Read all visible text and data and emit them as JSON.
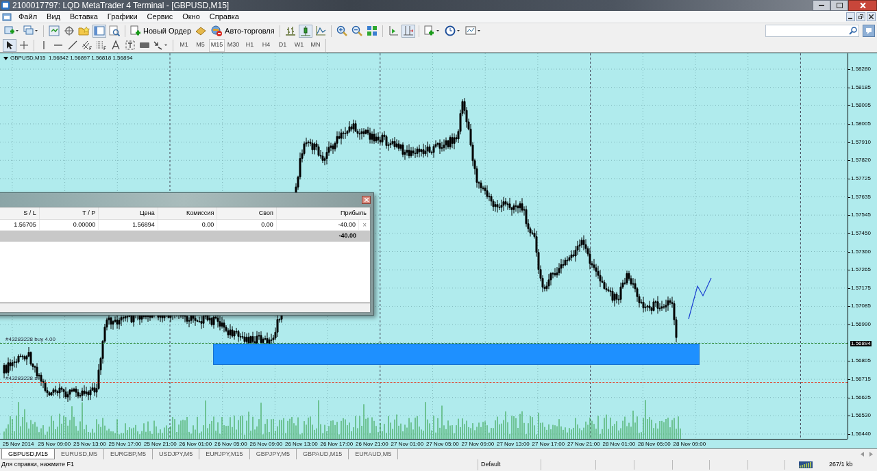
{
  "window": {
    "title": "2100017797: LQD MetaTrader 4 Terminal - [GBPUSD,M15]"
  },
  "menu": [
    "Файл",
    "Вид",
    "Вставка",
    "Графики",
    "Сервис",
    "Окно",
    "Справка"
  ],
  "toolbar": {
    "new_order": "Новый Ордер",
    "autotrading": "Авто-торговля"
  },
  "timeframes": [
    {
      "label": "M1",
      "selected": false
    },
    {
      "label": "M5",
      "selected": false
    },
    {
      "label": "M15",
      "selected": true
    },
    {
      "label": "M30",
      "selected": false
    },
    {
      "label": "H1",
      "selected": false
    },
    {
      "label": "H4",
      "selected": false
    },
    {
      "label": "D1",
      "selected": false
    },
    {
      "label": "W1",
      "selected": false
    },
    {
      "label": "MN",
      "selected": false
    }
  ],
  "chart": {
    "header": "GBPUSD,M15  1.56842 1.56897 1.56818 1.56894",
    "price_ticks": [
      "1.58280",
      "1.58185",
      "1.58095",
      "1.58005",
      "1.57910",
      "1.57820",
      "1.57725",
      "1.57635",
      "1.57545",
      "1.57450",
      "1.57360",
      "1.57265",
      "1.57175",
      "1.57085",
      "1.56990",
      "1.56894",
      "1.56805",
      "1.56715",
      "1.56625",
      "1.56530",
      "1.56440"
    ],
    "time_ticks": [
      "25 Nov 2014",
      "25 Nov 09:00",
      "25 Nov 13:00",
      "25 Nov 17:00",
      "25 Nov 21:00",
      "26 Nov 01:00",
      "26 Nov 05:00",
      "26 Nov 09:00",
      "26 Nov 13:00",
      "26 Nov 17:00",
      "26 Nov 21:00",
      "27 Nov 01:00",
      "27 Nov 05:00",
      "27 Nov 09:00",
      "27 Nov 13:00",
      "27 Nov 17:00",
      "27 Nov 21:00",
      "28 Nov 01:00",
      "28 Nov 05:00",
      "28 Nov 09:00"
    ],
    "order_lines": [
      {
        "label": "#43283228 buy 4.00",
        "kind": "entry"
      },
      {
        "label": "#43283228 sl",
        "kind": "stop"
      }
    ]
  },
  "trade_window": {
    "columns": [
      "S / L",
      "T / P",
      "Цена",
      "Комиссия",
      "Своп",
      "Прибыль"
    ],
    "rows": [
      {
        "cells": [
          "1.56705",
          "0.00000",
          "1.56894",
          "0.00",
          "0.00",
          "-40.00"
        ],
        "close": "×"
      }
    ],
    "total": "-40.00"
  },
  "chart_tabs": [
    {
      "label": "GBPUSD,M15",
      "selected": true
    },
    {
      "label": "EURUSD,M5",
      "selected": false
    },
    {
      "label": "EURGBP,M5",
      "selected": false
    },
    {
      "label": "USDJPY,M5",
      "selected": false
    },
    {
      "label": "EURJPY,M15",
      "selected": false
    },
    {
      "label": "GBPJPY,M5",
      "selected": false
    },
    {
      "label": "GBPAUD,M15",
      "selected": false
    },
    {
      "label": "EURAUD,M5",
      "selected": false
    }
  ],
  "status_bar": {
    "help": "Для справки, нажмите F1",
    "profile": "Default",
    "traffic": "267/1 kb"
  }
}
